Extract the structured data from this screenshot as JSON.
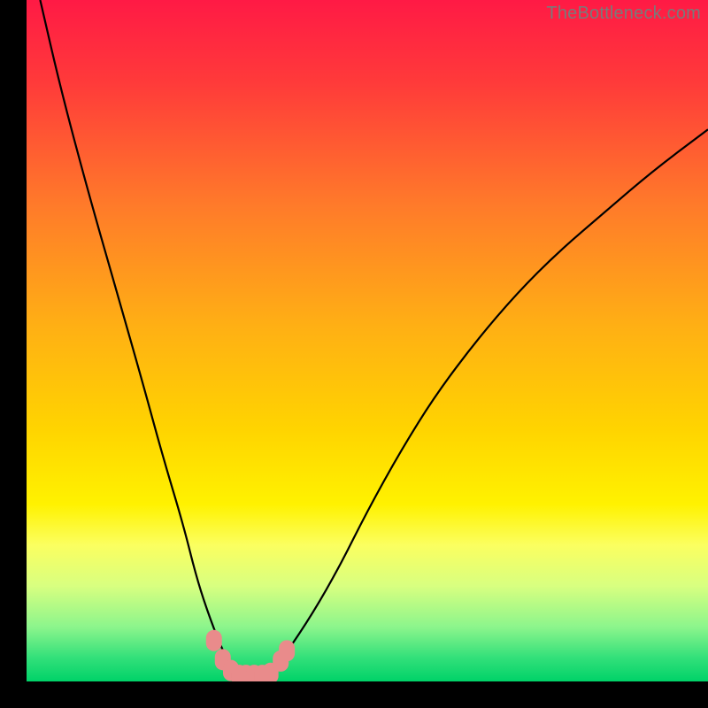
{
  "watermark": {
    "text": "TheBottleneck.com"
  },
  "chart_data": {
    "type": "line",
    "title": "",
    "xlabel": "",
    "ylabel": "",
    "xlim": [
      0,
      100
    ],
    "ylim": [
      0,
      100
    ],
    "grid": false,
    "legend": false,
    "background_gradient": {
      "stops": [
        {
          "offset": 0.0,
          "color": "#ff1a45"
        },
        {
          "offset": 0.12,
          "color": "#ff3a3a"
        },
        {
          "offset": 0.3,
          "color": "#ff7a2a"
        },
        {
          "offset": 0.48,
          "color": "#ffb014"
        },
        {
          "offset": 0.63,
          "color": "#ffd400"
        },
        {
          "offset": 0.74,
          "color": "#fff200"
        },
        {
          "offset": 0.8,
          "color": "#fbff60"
        },
        {
          "offset": 0.86,
          "color": "#d8ff80"
        },
        {
          "offset": 0.92,
          "color": "#8cf58c"
        },
        {
          "offset": 0.965,
          "color": "#33e07a"
        },
        {
          "offset": 1.0,
          "color": "#00d268"
        }
      ]
    },
    "series": [
      {
        "name": "bottleneck-curve",
        "stroke": "#000000",
        "x": [
          2,
          5,
          9,
          13,
          17,
          20,
          23,
          25,
          27,
          29,
          30.5,
          32,
          34,
          36,
          38,
          42,
          46,
          50,
          55,
          60,
          66,
          72,
          78,
          85,
          92,
          100
        ],
        "y": [
          100,
          87,
          72,
          58,
          44,
          33,
          23,
          15,
          9,
          4,
          1.5,
          0.7,
          0.7,
          1.5,
          4,
          10,
          17,
          25,
          34,
          42,
          50,
          57,
          63,
          69,
          75,
          81
        ]
      }
    ],
    "markers": {
      "name": "sweet-spot-markers",
      "color": "#e98b8b",
      "points": [
        {
          "x": 27.5,
          "y": 6.0
        },
        {
          "x": 28.8,
          "y": 3.2
        },
        {
          "x": 30.0,
          "y": 1.6
        },
        {
          "x": 31.2,
          "y": 0.9
        },
        {
          "x": 32.2,
          "y": 0.9
        },
        {
          "x": 33.4,
          "y": 0.9
        },
        {
          "x": 34.6,
          "y": 0.9
        },
        {
          "x": 35.8,
          "y": 1.2
        },
        {
          "x": 37.3,
          "y": 3.0
        },
        {
          "x": 38.2,
          "y": 4.5
        }
      ]
    }
  }
}
